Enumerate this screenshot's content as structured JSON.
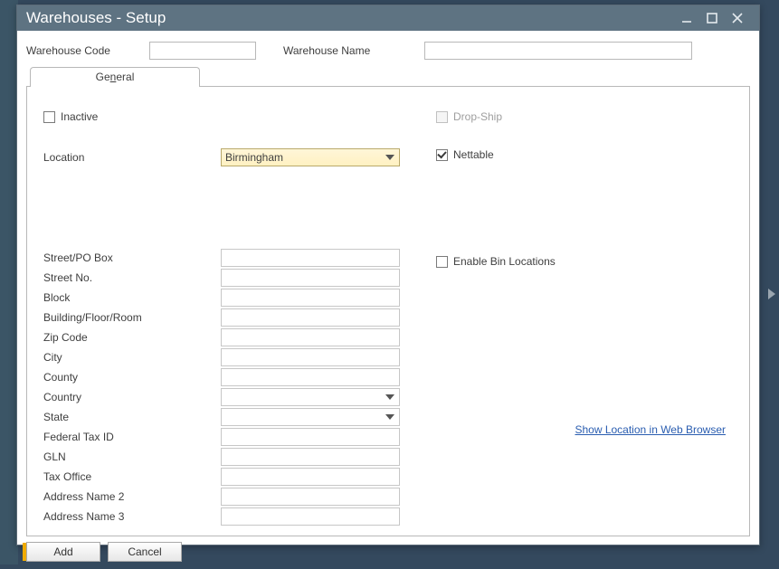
{
  "window": {
    "title": "Warehouses - Setup"
  },
  "header": {
    "code_label": "Warehouse Code",
    "code_value": "",
    "name_label": "Warehouse Name",
    "name_value": ""
  },
  "tabs": {
    "general": "General"
  },
  "form": {
    "inactive_label": "Inactive",
    "inactive_checked": false,
    "dropship_label": "Drop-Ship",
    "dropship_checked": false,
    "location_label": "Location",
    "location_value": "Birmingham",
    "nettable_label": "Nettable",
    "nettable_checked": true,
    "enablebin_label": "Enable Bin Locations",
    "enablebin_checked": false
  },
  "address": {
    "street_label": "Street/PO Box",
    "streetno_label": "Street No.",
    "block_label": "Block",
    "bfr_label": "Building/Floor/Room",
    "zip_label": "Zip Code",
    "city_label": "City",
    "county_label": "County",
    "country_label": "Country",
    "state_label": "State",
    "fedtax_label": "Federal Tax ID",
    "gln_label": "GLN",
    "taxoffice_label": "Tax Office",
    "addr2_label": "Address Name 2",
    "addr3_label": "Address Name 3"
  },
  "links": {
    "show_in_browser": "Show Location in Web Browser"
  },
  "buttons": {
    "add": "Add",
    "cancel": "Cancel"
  }
}
